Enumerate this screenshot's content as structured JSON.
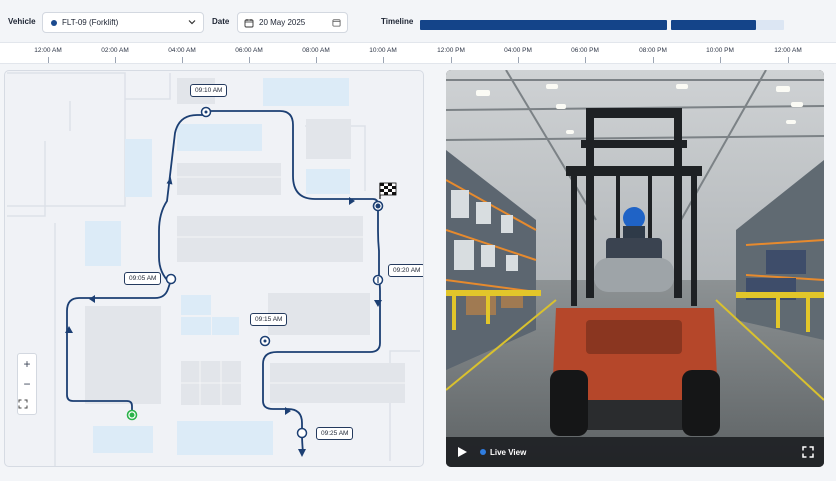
{
  "toolbar": {
    "vehicle_label": "Vehicle",
    "vehicle_value": "FLT-09 (Forklift)",
    "date_label": "Date",
    "date_value": "20 May 2025",
    "timeline_label": "Timeline",
    "timeline_progress": 0.93
  },
  "ruler": {
    "ticks": [
      "12:00 AM",
      "02:00 AM",
      "04:00 AM",
      "06:00 AM",
      "08:00 AM",
      "10:00 AM",
      "12:00 PM",
      "04:00 PM",
      "06:00 PM",
      "08:00 PM",
      "10:00 PM",
      "12:00 AM"
    ]
  },
  "map": {
    "waypoints": [
      {
        "time": "09:10 AM"
      },
      {
        "time": "09:05 AM"
      },
      {
        "time": "09:15 AM"
      },
      {
        "time": "09:20 AM"
      },
      {
        "time": "09:25 AM"
      }
    ],
    "zoom_in": "+",
    "zoom_out": "−",
    "route_color": "#1c3f73",
    "start_color": "#2bb34a"
  },
  "video": {
    "status_label": "Live View",
    "accent": "#2f7de0"
  }
}
